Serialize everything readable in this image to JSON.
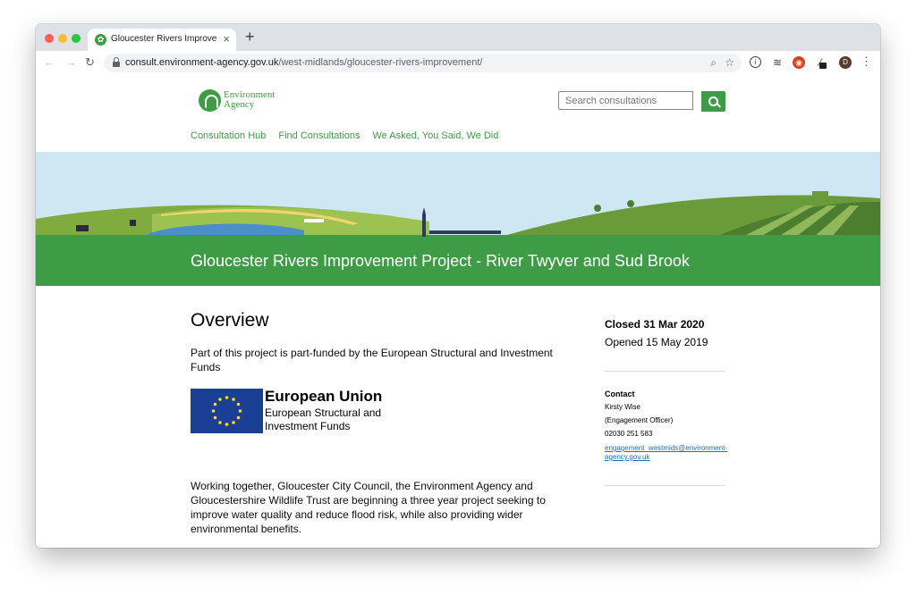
{
  "browser": {
    "tab_title": "Gloucester Rivers Improvement Project - River Twyver and Sud Brook",
    "url_host": "consult.environment-agency.gov.uk",
    "url_path": "/west-midlands/gloucester-rivers-improvement/",
    "avatar_letter": "D"
  },
  "header": {
    "logo_line1": "Environment",
    "logo_line2": "Agency",
    "search_placeholder": "Search consultations"
  },
  "nav": {
    "items": [
      "Consultation Hub",
      "Find Consultations",
      "We Asked, You Said, We Did"
    ]
  },
  "page": {
    "title": "Gloucester Rivers Improvement Project - River Twyver and Sud Brook",
    "overview_heading": "Overview",
    "funding_text": "Part of this project is part-funded by the European Structural and Investment Funds",
    "eu_title": "European Union",
    "eu_subtitle": "European Structural and Investment Funds",
    "working_text": "Working together, Gloucester City Council, the Environment Agency and Gloucestershire Wildlife Trust are beginning a three year project seeking to improve water quality and reduce flood risk, while also providing wider environmental benefits."
  },
  "sidebar": {
    "closed": "Closed 31 Mar 2020",
    "opened": "Opened 15 May 2019",
    "contact_heading": "Contact",
    "contact_name": "Kirsty Wise",
    "contact_role": "(Engagement Officer)",
    "contact_phone": "02030 251 583",
    "contact_email": "engagement_westmids@environment-agency.gov.uk"
  },
  "colors": {
    "brand_green": "#3f9c46",
    "link_blue": "#1d70b8",
    "eu_blue": "#1b3f95",
    "eu_star": "#ffdd00"
  }
}
